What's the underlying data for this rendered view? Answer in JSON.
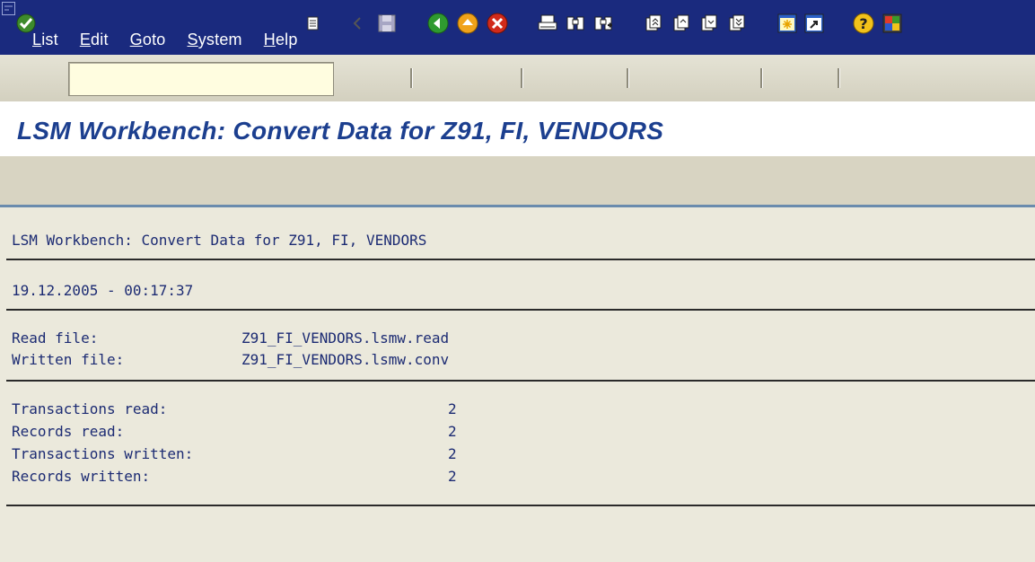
{
  "menu": {
    "items": [
      "List",
      "Edit",
      "Goto",
      "System",
      "Help"
    ]
  },
  "toolbar": {
    "command_field_value": "",
    "icons": [
      "enter-icon",
      "command-menu-icon",
      "back-arrow-icon",
      "save-icon",
      "back-icon",
      "exit-icon",
      "cancel-icon",
      "print-icon",
      "find-icon",
      "find-next-icon",
      "first-page-icon",
      "previous-page-icon",
      "next-page-icon",
      "last-page-icon",
      "create-session-icon",
      "shortcut-icon",
      "help-icon",
      "layout-icon"
    ]
  },
  "title": "LSM Workbench: Convert Data for Z91, FI, VENDORS",
  "report": {
    "heading": "LSM Workbench: Convert Data for Z91, FI, VENDORS",
    "timestamp": "19.12.2005 - 00:17:37",
    "files": [
      {
        "label": "Read file:",
        "value": "Z91_FI_VENDORS.lsmw.read"
      },
      {
        "label": "Written file:",
        "value": "Z91_FI_VENDORS.lsmw.conv"
      }
    ],
    "stats": [
      {
        "label": "Transactions read:",
        "value": "2"
      },
      {
        "label": "Records read:",
        "value": "2"
      },
      {
        "label": "Transactions written:",
        "value": "2"
      },
      {
        "label": "Records written:",
        "value": "2"
      }
    ]
  },
  "colors": {
    "menubar": "#1a2a7e",
    "title": "#1c3f8f",
    "background": "#ebe9dc"
  }
}
